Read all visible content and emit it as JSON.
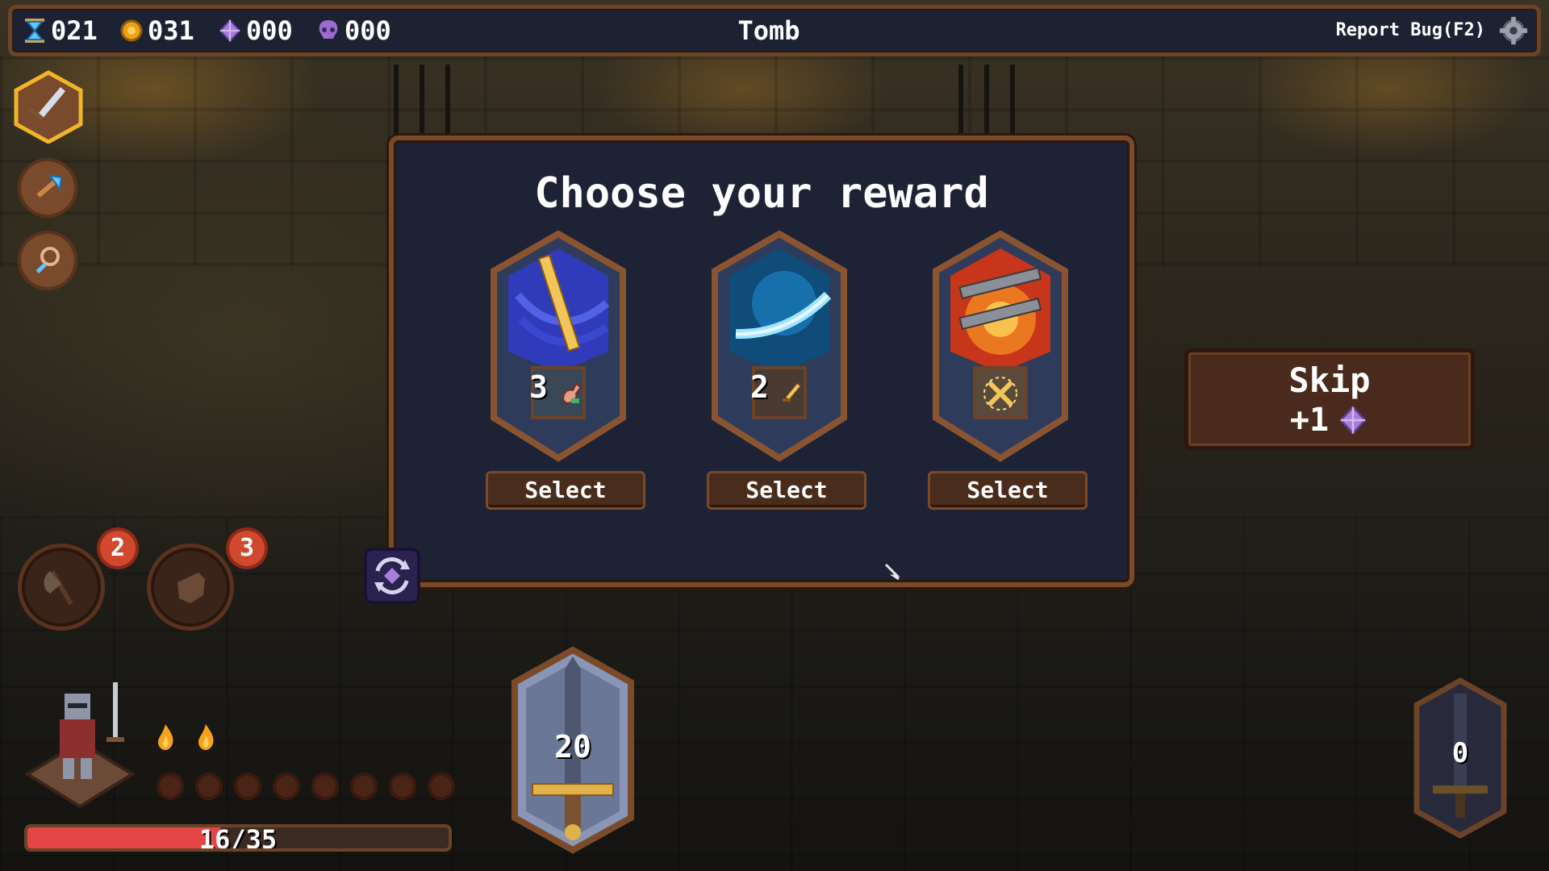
{
  "topbar": {
    "resources": [
      {
        "icon": "hourglass-icon",
        "value": "021"
      },
      {
        "icon": "gold-coin-icon",
        "value": "031"
      },
      {
        "icon": "purple-gem-icon",
        "value": "000"
      },
      {
        "icon": "skull-icon",
        "value": "000"
      }
    ],
    "location": "Tomb",
    "report_bug": "Report Bug(F2)",
    "settings_icon": "gear-icon"
  },
  "sidebar": {
    "skills": [
      {
        "icon": "sword-icon",
        "selected": true
      },
      {
        "icon": "axe-icon",
        "selected": false
      },
      {
        "icon": "magnifier-icon",
        "selected": false
      }
    ]
  },
  "modal": {
    "title": "Choose your reward",
    "rewards": [
      {
        "name": "blue-sword-card",
        "count": "3",
        "sub_icon": "flexed-arm-icon",
        "select_label": "Select"
      },
      {
        "name": "water-blade-card",
        "count": "2",
        "sub_icon": "dagger-icon",
        "select_label": "Select"
      },
      {
        "name": "fire-weapon-card",
        "count": "",
        "sub_icon": "crossed-swords-icon",
        "select_label": "Select"
      }
    ],
    "reroll_icon": "reroll-icon"
  },
  "skip": {
    "label": "Skip",
    "reward": "+1",
    "reward_icon": "purple-gem-icon"
  },
  "abilities": [
    {
      "icon": "axe-icon",
      "badge": "2"
    },
    {
      "icon": "fist-icon",
      "badge": "3"
    }
  ],
  "player": {
    "hp_text": "16/35",
    "hp_fraction": 0.457,
    "flames": 2,
    "orbs": 8
  },
  "weapon_main": {
    "value": "20"
  },
  "weapon_secondary": {
    "value": "0"
  },
  "colors": {
    "frame": "#7b4a29",
    "panel": "#1e2235",
    "hp": "#e24646",
    "badge": "#d0492f",
    "gem": "#a77ed9"
  }
}
